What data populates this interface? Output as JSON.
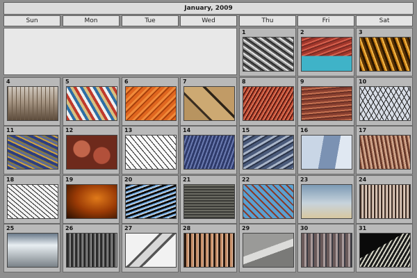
{
  "calendar": {
    "title": "January, 2009",
    "weekdays": [
      "Sun",
      "Mon",
      "Tue",
      "Wed",
      "Thu",
      "Fri",
      "Sat"
    ],
    "days": [
      {
        "num": "1",
        "bg": "repeating-linear-gradient(35deg,#2b2b2b 0 2px,#9a9a9a 2px 4px,#e6e6e6 4px 6px,#5a5a5a 6px 8px)"
      },
      {
        "num": "2",
        "bg": "linear-gradient(180deg,transparent 55%,#3fb3c8 55%),repeating-linear-gradient(160deg,#a2372c 0 3px,#d6604d 3px 5px,#7a2a22 5px 7px)"
      },
      {
        "num": "3",
        "bg": "repeating-linear-gradient(70deg,#2a1600 0 3px,#c47a12 3px 5px,#f1b545 5px 7px,#5c3405 7px 10px)"
      },
      {
        "num": "4",
        "bg": "repeating-linear-gradient(90deg,#6b5a48 0 1px,transparent 1px 6px),linear-gradient(180deg,#cfc7bd 0%,#a49381 45%,#5b4a3a 100%)"
      },
      {
        "num": "5",
        "bg": "repeating-linear-gradient(60deg,#c0392b 0 4px,#f0f0f0 4px 8px,#2d6ea5 8px 12px,#d8c080 12px 16px)"
      },
      {
        "num": "6",
        "bg": "repeating-linear-gradient(135deg,#e0661f 0 4px,#f08a3a 4px 7px,#a8410d 7px 9px)"
      },
      {
        "num": "7",
        "bg": "linear-gradient(45deg,#b89460 0 30%,#3b2f22 30% 34%,#cda972 34% 62%,#2e2418 62% 66%,#c19b66 66%)"
      },
      {
        "num": "8",
        "bg": "repeating-linear-gradient(120deg,#5e1810 0 2px,#c44d34 2px 4px,#e89070 4px 5px)"
      },
      {
        "num": "9",
        "bg": "repeating-linear-gradient(175deg,#8a4030 0 3px,#c47050 3px 5px,#6a2f24 5px 7px)"
      },
      {
        "num": "10",
        "bg": "repeating-linear-gradient(60deg,transparent 0 5px,#1a1a1a 5px 6px),repeating-linear-gradient(120deg,#d8dde6 0 6px,#2a2a2a 6px 7px)"
      },
      {
        "num": "11",
        "bg": "repeating-linear-gradient(25deg,#2c3e82 0 4px,#d2a43a 4px 6px,#5a6a9a 6px 9px,#8a7a3a 9px 11px)"
      },
      {
        "num": "12",
        "bg": "radial-gradient(circle at 30% 40%,#c2654a 0 20%,transparent 22%),radial-gradient(circle at 70% 60%,#b2503a 0 20%,transparent 22%),#6e2a1c"
      },
      {
        "num": "13",
        "bg": "repeating-linear-gradient(50deg,#fafafa 0 5px,#1a1a1a 5px 6px),repeating-linear-gradient(130deg,transparent 0 6px,#222 6px 7px)"
      },
      {
        "num": "14",
        "bg": "repeating-linear-gradient(110deg,#2e3a6a 0 3px,#6a7ab0 3px 5px),repeating-linear-gradient(20deg,transparent 0 6px,#1c2440 6px 7px)"
      },
      {
        "num": "15",
        "bg": "repeating-linear-gradient(150deg,#4a5a7a 0 4px,#a8b4c8 4px 7px,#2a3348 7px 9px)"
      },
      {
        "num": "16",
        "bg": "linear-gradient(100deg,#c9d6e6 0 40%,#7b92b3 40% 70%,#e0e8f2 70%)"
      },
      {
        "num": "17",
        "bg": "repeating-linear-gradient(80deg,#6a3a2a 0 3px,#c8957a 3px 5px,#e2c0a8 5px 6px)"
      },
      {
        "num": "18",
        "bg": "repeating-linear-gradient(40deg,#f4f4f4 0 4px,#202020 4px 5px),repeating-linear-gradient(140deg,transparent 0 5px,#2a2a2a 5px 6px)"
      },
      {
        "num": "19",
        "bg": "radial-gradient(ellipse at 60% 40%,#e07a1a 0%,#9a3a05 50%,#2a1002 100%)"
      },
      {
        "num": "20",
        "bg": "repeating-linear-gradient(160deg,#0a0a0a 0 3px,#6fa8e0 3px 5px,#f0f0f0 5px 6px)"
      },
      {
        "num": "21",
        "bg": "repeating-linear-gradient(0deg,#3a3a36 0 2px,#6a6a62 2px 4px),repeating-linear-gradient(90deg,transparent 0 4px,#2a2a26 4px 5px)"
      },
      {
        "num": "22",
        "bg": "repeating-linear-gradient(45deg,#8a3a2a 0 2px,#5aa0d0 2px 7px),repeating-linear-gradient(135deg,transparent 0 7px,#7a2a1a 7px 9px)"
      },
      {
        "num": "23",
        "bg": "linear-gradient(180deg,#7c9ab4 0%,#c7d3dc 55%,#d8c8a0 100%)"
      },
      {
        "num": "24",
        "bg": "repeating-linear-gradient(90deg,#3a2a22 0 2px,#c8b0a0 2px 4px,#f0e2d6 4px 5px)"
      },
      {
        "num": "25",
        "bg": "linear-gradient(180deg,#6a7a8a 0%,#e8eef2 35%,#7a8288 100%)"
      },
      {
        "num": "26",
        "bg": "repeating-linear-gradient(90deg,#2a2a2a 0 3px,#6a6a6a 3px 5px,#9a9a9a 5px 6px)"
      },
      {
        "num": "27",
        "bg": "linear-gradient(135deg,#f2f2f2 0 40%,#555 40% 44%,#d8d8d8 44% 56%,#555 56% 60%,#f2f2f2 60%)"
      },
      {
        "num": "28",
        "bg": "repeating-linear-gradient(90deg,#2a1a10 0 3px,#c8906a 3px 6px,#e8c8b0 6px 7px)"
      },
      {
        "num": "29",
        "bg": "linear-gradient(160deg,#9a9a98 0 45%,#dcdcda 45% 60%,#7a7a78 60%)"
      },
      {
        "num": "30",
        "bg": "repeating-linear-gradient(90deg,#6a5a5a 0 4px,#a89a9a 4px 7px,#3a3a42 7px 9px)"
      },
      {
        "num": "31",
        "bg": "linear-gradient(150deg,#0a0a0a 0 40%,transparent 40%),repeating-linear-gradient(120deg,#1a1a1a 0 3px,#d8d8c8 3px 5px)"
      }
    ]
  }
}
